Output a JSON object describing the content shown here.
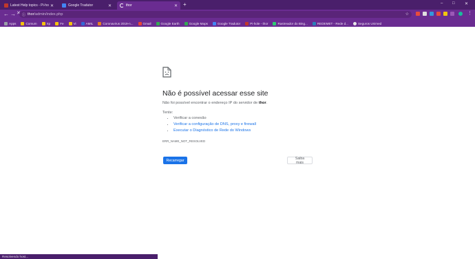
{
  "tabs": [
    {
      "label": "Latest Help topics - Pi-hole Use...",
      "active": false,
      "favicon_color": "#c0392b"
    },
    {
      "label": "Google Tradutor",
      "active": false,
      "favicon_color": "#4285f4"
    },
    {
      "label": "thor",
      "active": true,
      "favicon_color": "#ffffff"
    }
  ],
  "newtab_label": "+",
  "window_controls": {
    "minimize": "–",
    "maximize": "□",
    "close": "✕"
  },
  "omnibox": {
    "host": "thor",
    "path": "/admin/index.php"
  },
  "bookmarks": [
    {
      "label": "Apps",
      "color": "#9aa0a6"
    },
    {
      "label": "Comum",
      "color": "#f4c20d"
    },
    {
      "label": "Xp",
      "color": "#f4c20d"
    },
    {
      "label": "Fe",
      "color": "#f4c20d"
    },
    {
      "label": "Vi",
      "color": "#f4c20d"
    },
    {
      "label": "AMIL",
      "color": "#3367d6"
    },
    {
      "label": "Coronavirus 2019-n...",
      "color": "#e67e22"
    },
    {
      "label": "Gmail",
      "color": "#ea4335"
    },
    {
      "label": "Google Earth",
      "color": "#34a853"
    },
    {
      "label": "Google Maps",
      "color": "#34a853"
    },
    {
      "label": "Google Tradutor",
      "color": "#4285f4"
    },
    {
      "label": "Pi-hole - thor",
      "color": "#c0392b"
    },
    {
      "label": "Rastreador do Bing...",
      "color": "#2ecc71"
    },
    {
      "label": "REDEMET - Rede d...",
      "color": "#2980b9"
    },
    {
      "label": "Seguros Unimed",
      "color": "#e8e8e8"
    }
  ],
  "error": {
    "title": "Não é possível acessar esse site",
    "description_prefix": "Não foi possível encontrar o endereço IP do servidor de ",
    "description_host": "thor",
    "description_suffix": ".",
    "try_heading": "Tente:",
    "tips": [
      {
        "text": "Verificar a conexão",
        "link": false
      },
      {
        "text": "Verificar a configuração de DNS, proxy e firewall",
        "link": true
      },
      {
        "text": "Executar o Diagnóstico de Rede do Windows",
        "link": true
      }
    ],
    "code": "ERR_NAME_NOT_RESOLVED",
    "reload_label": "Recarregar",
    "details_label": "Saiba mais"
  },
  "status_text": "Resolvendo host..."
}
